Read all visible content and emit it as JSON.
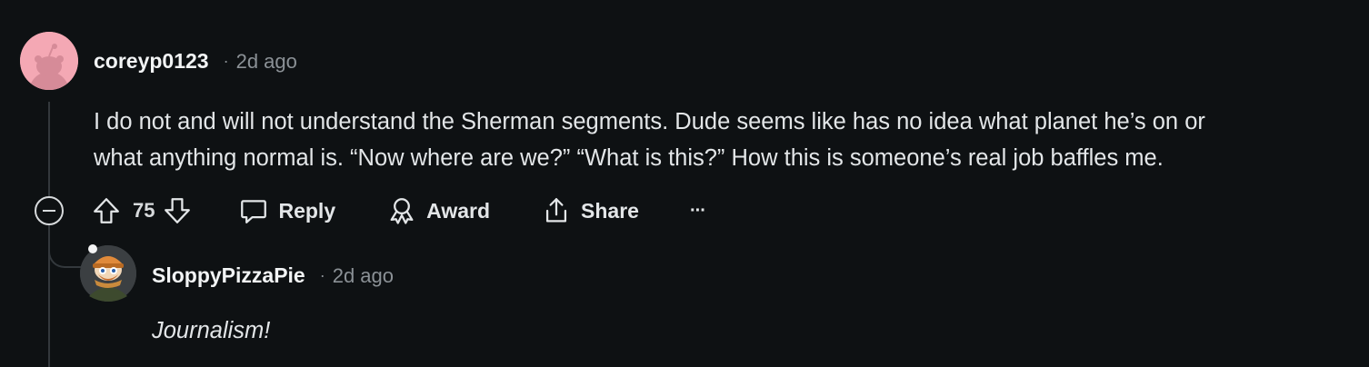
{
  "comment": {
    "username": "coreyp0123",
    "separator": "·",
    "timestamp": "2d ago",
    "body_lines": [
      "I do not and will not understand the Sherman segments. Dude seems like has no idea what planet he’s on or",
      "what anything normal is. “Now where are we?” “What is this?” How this is someone’s real job baffles me."
    ],
    "vote_count": "75",
    "actions": {
      "reply": "Reply",
      "award": "Award",
      "share": "Share",
      "more": "···"
    }
  },
  "reply": {
    "username": "SloppyPizzaPie",
    "separator": "·",
    "timestamp": "2d ago",
    "body": "Journalism!"
  },
  "colors": {
    "background": "#0e1113",
    "avatar_pink": "#f4a8b4",
    "meta_gray": "#8b9196",
    "text": "#e3e6e8"
  },
  "icons": [
    "collapse-icon",
    "upvote-icon",
    "downvote-icon",
    "comment-bubble-icon",
    "award-icon",
    "share-icon",
    "more-dots-icon"
  ]
}
